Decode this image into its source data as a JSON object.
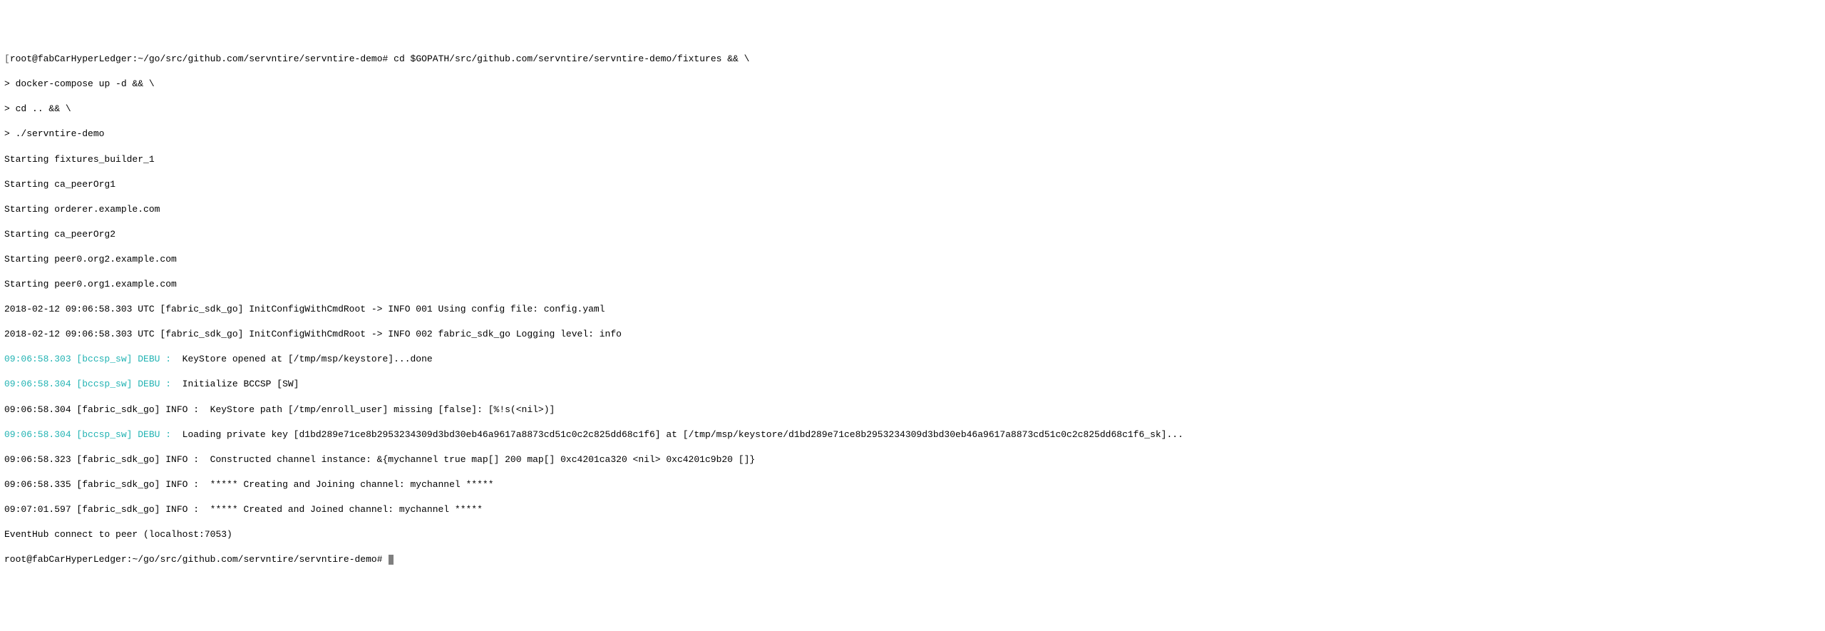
{
  "prompt": {
    "open_bracket": "[",
    "close_bracket": "]",
    "user_host": "root@fabCarHyperLedger",
    "path": "~/go/src/github.com/servntire/servntire-demo",
    "hash": "#",
    "cmd1": "cd $GOPATH/src/github.com/servntire/servntire-demo/fixtures && \\",
    "cont_prompt": ">",
    "cmd2": "docker-compose up -d && \\",
    "cmd3": "cd .. && \\",
    "cmd4": "./servntire-demo"
  },
  "output": {
    "l1": "Starting fixtures_builder_1",
    "l2": "Starting ca_peerOrg1",
    "l3": "Starting orderer.example.com",
    "l4": "Starting ca_peerOrg2",
    "l5": "Starting peer0.org2.example.com",
    "l6": "Starting peer0.org1.example.com",
    "l7": "2018-02-12 09:06:58.303 UTC [fabric_sdk_go] InitConfigWithCmdRoot -> INFO 001 Using config file: config.yaml",
    "l8": "2018-02-12 09:06:58.303 UTC [fabric_sdk_go] InitConfigWithCmdRoot -> INFO 002 fabric_sdk_go Logging level: info",
    "l9a": "09:06:58.303 [bccsp_sw] DEBU :",
    "l9b": "  KeyStore opened at [/tmp/msp/keystore]...done",
    "l10a": "09:06:58.304 [bccsp_sw] DEBU :",
    "l10b": "  Initialize BCCSP [SW]",
    "l11": "09:06:58.304 [fabric_sdk_go] INFO :  KeyStore path [/tmp/enroll_user] missing [false]: [%!s(<nil>)]",
    "l12a": "09:06:58.304 [bccsp_sw] DEBU :",
    "l12b": "  Loading private key [d1bd289e71ce8b2953234309d3bd30eb46a9617a8873cd51c0c2c825dd68c1f6] at [/tmp/msp/keystore/d1bd289e71ce8b2953234309d3bd30eb46a9617a8873cd51c0c2c825dd68c1f6_sk]...",
    "l13": "09:06:58.323 [fabric_sdk_go] INFO :  Constructed channel instance: &{mychannel true map[] 200 map[] 0xc4201ca320 <nil> 0xc4201c9b20 []}",
    "l14": "09:06:58.335 [fabric_sdk_go] INFO :  ***** Creating and Joining channel: mychannel *****",
    "l15": "09:07:01.597 [fabric_sdk_go] INFO :  ***** Created and Joined channel: mychannel *****",
    "l16": "EventHub connect to peer (localhost:7053)"
  },
  "final_prompt": {
    "user_host": "root@fabCarHyperLedger",
    "path": "~/go/src/github.com/servntire/servntire-demo",
    "hash": "#"
  }
}
